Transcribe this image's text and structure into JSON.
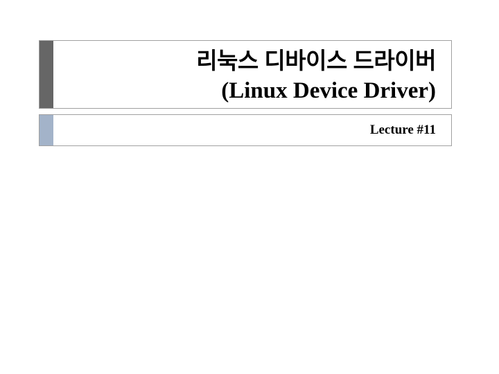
{
  "slide": {
    "title_line1": "리눅스 디바이스 드라이버",
    "title_line2": "(Linux Device Driver)",
    "subtitle": "Lecture #11"
  },
  "colors": {
    "title_accent": "#666666",
    "subtitle_accent": "#a3b3c9",
    "border": "#a0a0a0"
  }
}
